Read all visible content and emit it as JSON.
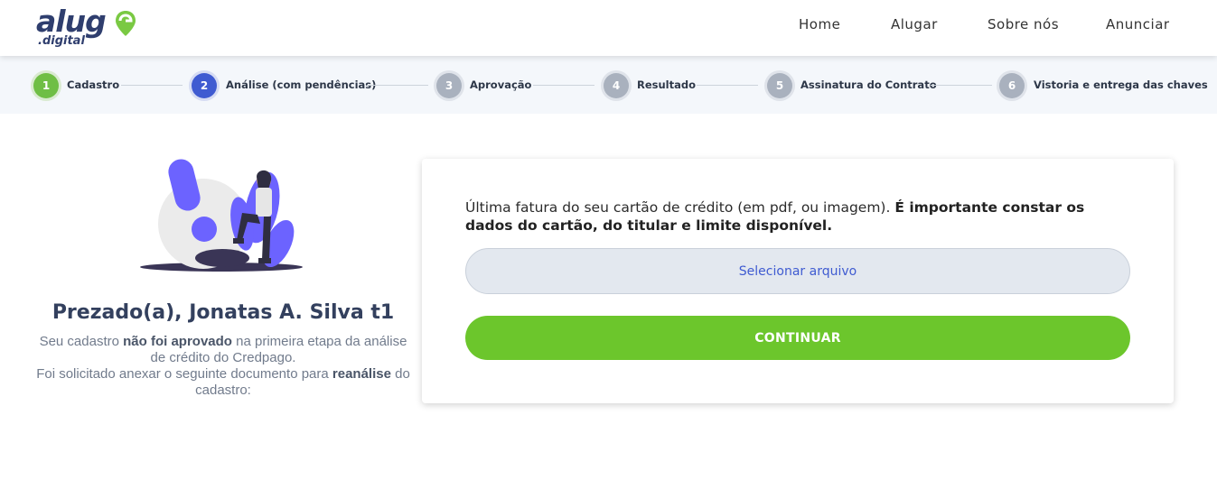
{
  "logo": {
    "word": "alug",
    "sub": ".digital",
    "brand_color": "#2f3e6e",
    "accent_color": "#7ac943"
  },
  "nav": [
    {
      "label": "Home"
    },
    {
      "label": "Alugar"
    },
    {
      "label": "Sobre nós"
    },
    {
      "label": "Anunciar"
    }
  ],
  "steps": [
    {
      "number": "1",
      "label": "Cadastro",
      "status": "done"
    },
    {
      "number": "2",
      "label": "Análise (com pendências)",
      "status": "current"
    },
    {
      "number": "3",
      "label": "Aprovação",
      "status": "pending"
    },
    {
      "number": "4",
      "label": "Resultado",
      "status": "pending"
    },
    {
      "number": "5",
      "label": "Assinatura do Contrato",
      "status": "pending"
    },
    {
      "number": "6",
      "label": "Vistoria e entrega das chaves",
      "status": "pending"
    }
  ],
  "main": {
    "greeting": "Prezado(a), Jonatas A. Silva t1",
    "desc_part1": "Seu cadastro ",
    "desc_bold1": "não foi aprovado",
    "desc_part2": " na primeira etapa da análise de crédito do Credpago.",
    "desc_part3": "Foi solicitado anexar o seguinte documento para ",
    "desc_bold2": "reanálise",
    "desc_part4": " do cadastro:"
  },
  "card": {
    "instruction": "Última fatura do seu cartão de crédito (em pdf, ou imagem). ",
    "instruction_bold": "É importante constar os dados do cartão, do titular e limite disponível.",
    "file_button": "Selecionar arquivo",
    "continue_button": "CONTINUAR"
  },
  "colors": {
    "done": "#6fbe45",
    "current": "#3f5bd1",
    "pending": "#a9b1be",
    "continue": "#6cc62c"
  }
}
